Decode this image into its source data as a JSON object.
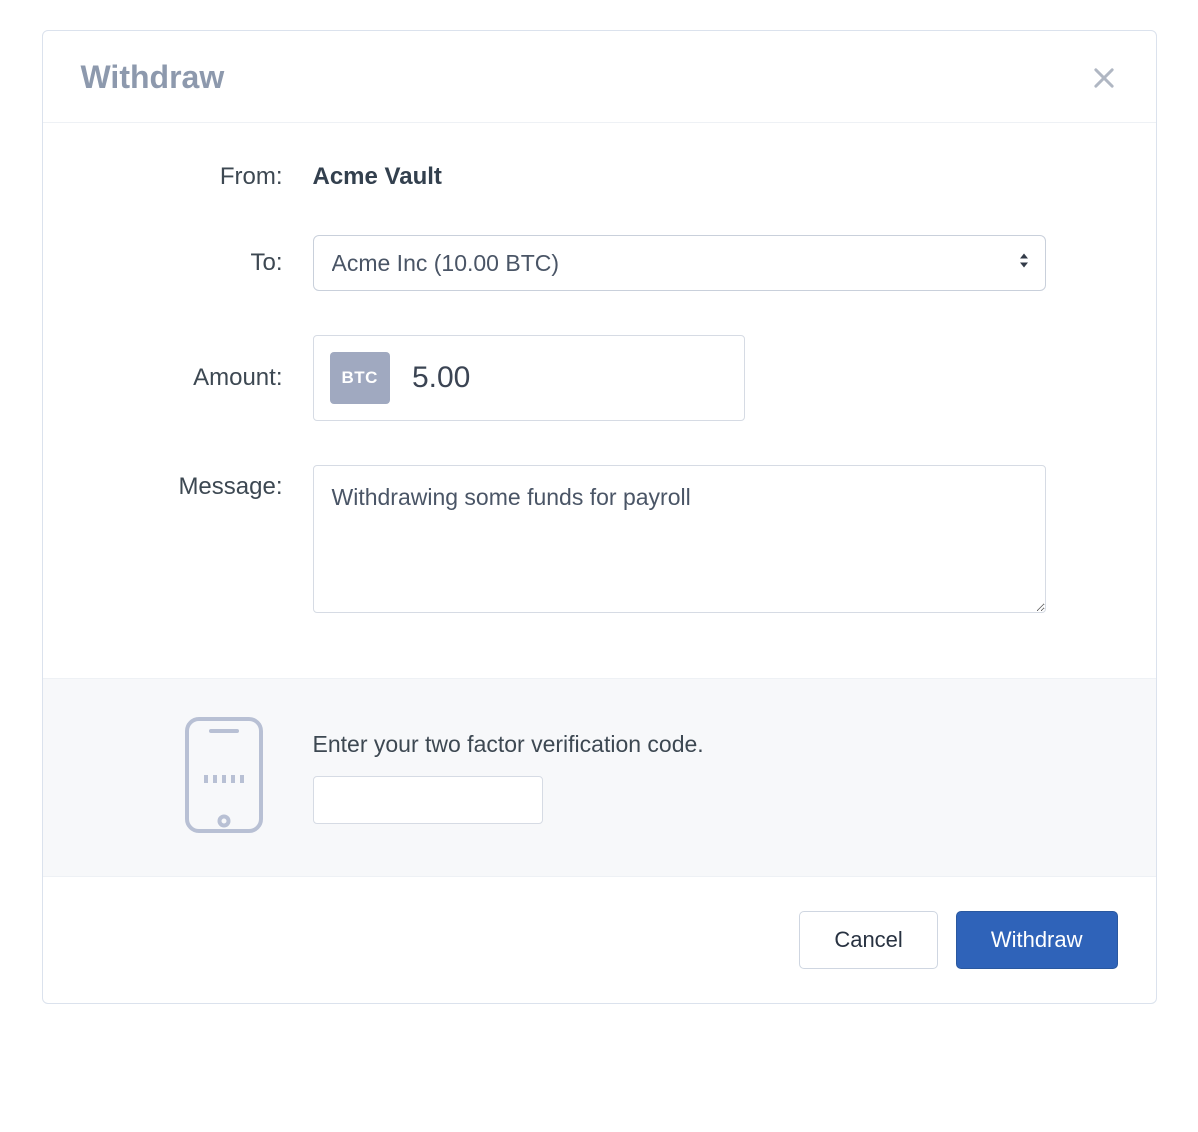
{
  "header": {
    "title": "Withdraw"
  },
  "form": {
    "labels": {
      "from": "From:",
      "to": "To:",
      "amount": "Amount:",
      "message": "Message:"
    },
    "from_value": "Acme Vault",
    "to_selected": "Acme Inc (10.00 BTC)",
    "amount_currency": "BTC",
    "amount_value": "5.00",
    "message_value": "Withdrawing some funds for payroll"
  },
  "twofa": {
    "prompt": "Enter your two factor verification code.",
    "code_value": ""
  },
  "footer": {
    "cancel_label": "Cancel",
    "submit_label": "Withdraw"
  }
}
